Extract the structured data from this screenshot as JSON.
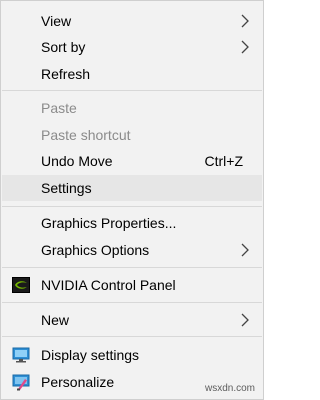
{
  "menu": {
    "items": [
      {
        "label": "View",
        "submenu": true
      },
      {
        "label": "Sort by",
        "submenu": true
      },
      {
        "label": "Refresh"
      },
      {
        "label": "Paste",
        "disabled": true
      },
      {
        "label": "Paste shortcut",
        "disabled": true
      },
      {
        "label": "Undo Move",
        "shortcut": "Ctrl+Z"
      },
      {
        "label": "Settings",
        "highlighted": true
      },
      {
        "label": "Graphics Properties..."
      },
      {
        "label": "Graphics Options",
        "submenu": true
      },
      {
        "label": "NVIDIA Control Panel",
        "icon": "nvidia-icon"
      },
      {
        "label": "New",
        "submenu": true
      },
      {
        "label": "Display settings",
        "icon": "display-icon"
      },
      {
        "label": "Personalize",
        "icon": "personalize-icon"
      }
    ]
  },
  "watermark": "wsxdn.com",
  "colors": {
    "menu_background": "#f2f2f2",
    "highlight": "#e6e6e6",
    "disabled_text": "#8b8b8b",
    "nvidia_green": "#76b900",
    "display_blue": "#2d8fd5"
  }
}
